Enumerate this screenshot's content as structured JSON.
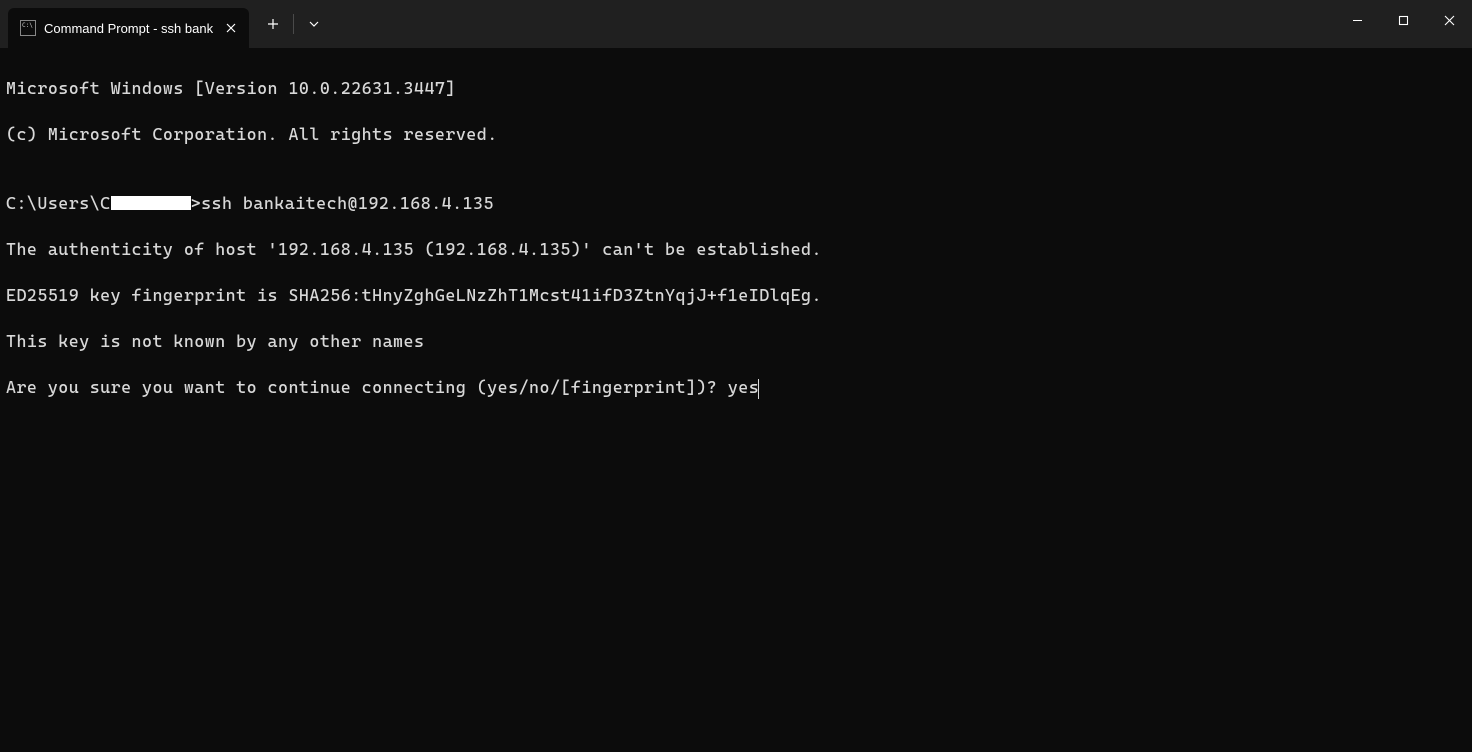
{
  "window": {
    "tab_title": "Command Prompt - ssh  bank"
  },
  "terminal": {
    "lines": [
      "Microsoft Windows [Version 10.0.22631.3447]",
      "(c) Microsoft Corporation. All rights reserved.",
      "",
      "",
      "The authenticity of host '192.168.4.135 (192.168.4.135)' can't be established.",
      "ED25519 key fingerprint is SHA256:tHnyZghGeLNzZhT1Mcst41ifD3ZtnYqjJ+f1eIDlqEg.",
      "This key is not known by any other names",
      ""
    ],
    "prompt_prefix": "C:\\Users\\C",
    "prompt_suffix": ">ssh bankaitech@192.168.4.135",
    "confirm_prompt": "Are you sure you want to continue connecting (yes/no/[fingerprint])? ",
    "user_input": "yes"
  }
}
